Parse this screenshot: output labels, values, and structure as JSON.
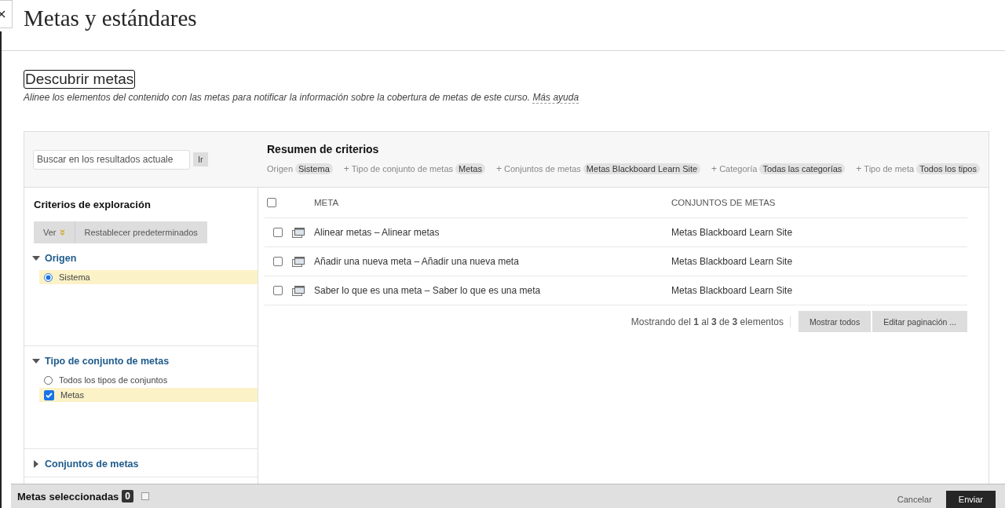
{
  "page": {
    "title": "Metas y estándares"
  },
  "section": {
    "heading": "Descubrir metas",
    "description": "Alinee los elementos del contenido con las metas para notificar la información sobre la cobertura de metas de este curso.",
    "help_link": "Más ayuda"
  },
  "search": {
    "placeholder": "Buscar en los resultados actuale",
    "button": "Ir"
  },
  "summary": {
    "title": "Resumen de criterios",
    "criteria": [
      {
        "label": "Origen",
        "value": "Sistema"
      },
      {
        "plus": "+",
        "label": "Tipo de conjunto de metas",
        "value": "Metas"
      },
      {
        "plus": "+",
        "label": "Conjuntos de metas",
        "value": "Metas Blackboard Learn Site"
      },
      {
        "plus": "+",
        "label": "Categoría",
        "value": "Todas las categorías"
      },
      {
        "plus": "+",
        "label": "Tipo de meta",
        "value": "Todos los tipos"
      }
    ]
  },
  "sidebar": {
    "title": "Criterios de exploración",
    "view_button": "Ver",
    "reset_button": "Restablecer predeterminados",
    "sections": [
      {
        "title": "Origen",
        "expanded": true,
        "options": [
          {
            "kind": "radio",
            "label": "Sistema",
            "checked": true
          }
        ]
      },
      {
        "title": "Tipo de conjunto de metas",
        "expanded": true,
        "options": [
          {
            "kind": "radio",
            "label": "Todos los tipos de conjuntos",
            "checked": false
          },
          {
            "kind": "checkbox",
            "label": "Metas",
            "checked": true
          }
        ]
      },
      {
        "title": "Conjuntos de metas",
        "expanded": false
      }
    ]
  },
  "table": {
    "columns": [
      "META",
      "CONJUNTOS DE METAS"
    ],
    "all_checked": false,
    "rows": [
      {
        "checked": false,
        "goal": "Alinear metas – Alinear metas",
        "set": "Metas Blackboard Learn Site"
      },
      {
        "checked": false,
        "goal": "Añadir una nueva meta – Añadir una nueva meta",
        "set": "Metas Blackboard Learn Site"
      },
      {
        "checked": false,
        "goal": "Saber lo que es una meta – Saber lo que es una meta",
        "set": "Metas Blackboard Learn Site"
      }
    ]
  },
  "pagination": {
    "parts": [
      "Mostrando del ",
      "1",
      " al ",
      "3",
      " de ",
      "3",
      " elementos"
    ],
    "show_all": "Mostrar todos",
    "edit": "Editar paginación ..."
  },
  "footer": {
    "label": "Metas seleccionadas",
    "count": "0",
    "cancel": "Cancelar",
    "submit": "Enviar"
  }
}
